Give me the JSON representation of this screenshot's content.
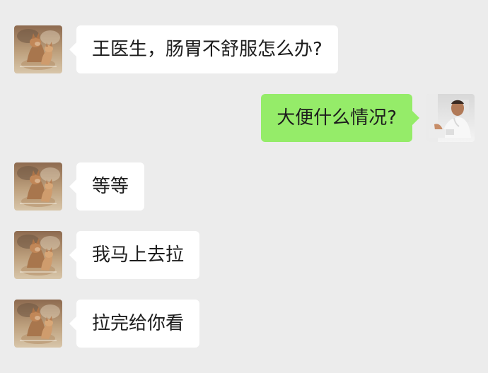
{
  "messages": [
    {
      "sender": "patient",
      "side": "left",
      "text": "王医生，肠胃不舒服怎么办?",
      "avatar_icon": "kangaroo-avatar-icon"
    },
    {
      "sender": "doctor",
      "side": "right",
      "text": "大便什么情况?",
      "avatar_icon": "doctor-avatar-icon"
    },
    {
      "sender": "patient",
      "side": "left",
      "text": "等等",
      "avatar_icon": "kangaroo-avatar-icon"
    },
    {
      "sender": "patient",
      "side": "left",
      "text": "我马上去拉",
      "avatar_icon": "kangaroo-avatar-icon"
    },
    {
      "sender": "patient",
      "side": "left",
      "text": "拉完给你看",
      "avatar_icon": "kangaroo-avatar-icon"
    }
  ],
  "theme": {
    "background": "#ececec",
    "received_bubble": "#ffffff",
    "sent_bubble": "#95ec69",
    "text_color": "#1d1d1d"
  }
}
